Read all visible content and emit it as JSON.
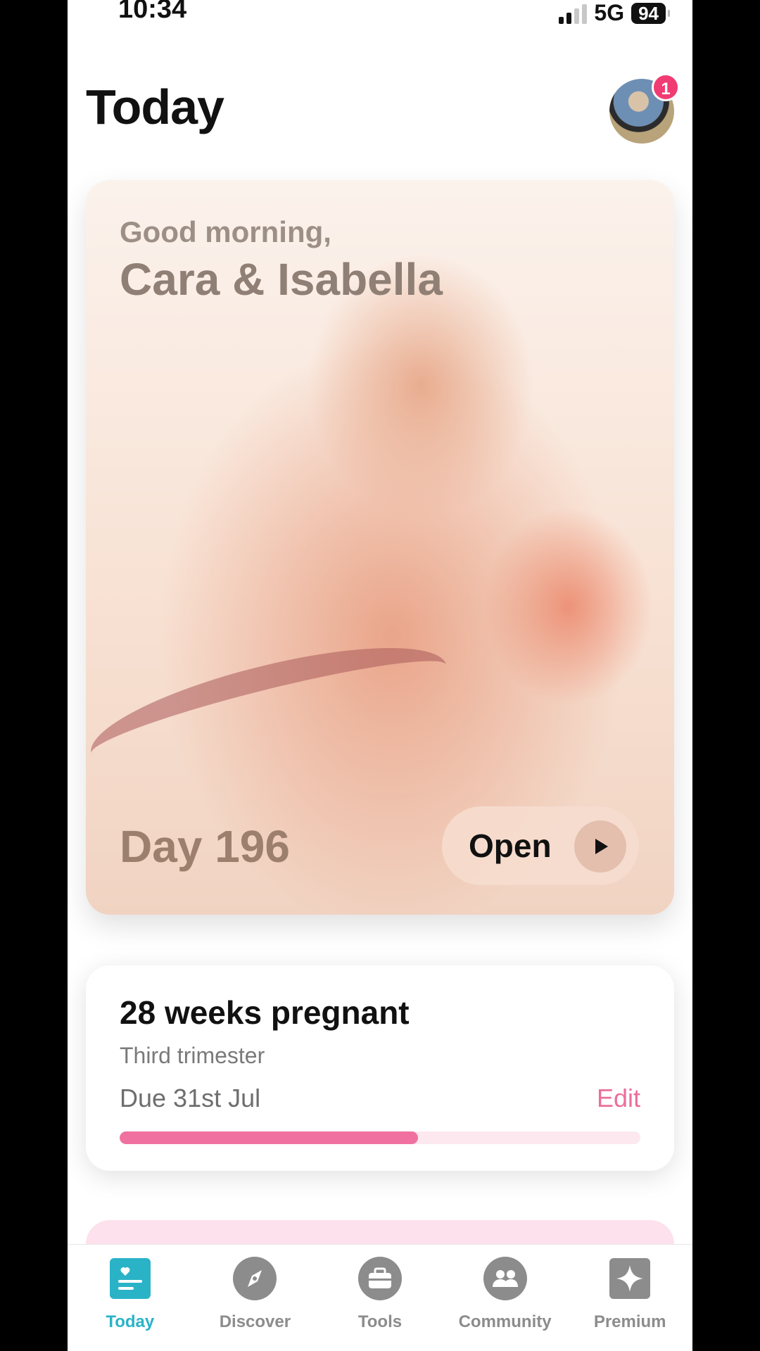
{
  "status_bar": {
    "time": "10:34",
    "network": "5G",
    "battery": "94"
  },
  "header": {
    "title": "Today",
    "notification_count": "1"
  },
  "hero": {
    "greeting": "Good morning,",
    "name": "Cara & Isabella",
    "day": "Day 196",
    "open_label": "Open"
  },
  "pregnancy": {
    "title": "28 weeks pregnant",
    "trimester": "Third trimester",
    "due": "Due 31st Jul",
    "edit_label": "Edit",
    "progress_fraction": 0.573
  },
  "tabs": [
    {
      "label": "Today",
      "icon": "today-icon",
      "active": true
    },
    {
      "label": "Discover",
      "icon": "compass-icon",
      "active": false
    },
    {
      "label": "Tools",
      "icon": "briefcase-icon",
      "active": false
    },
    {
      "label": "Community",
      "icon": "people-icon",
      "active": false
    },
    {
      "label": "Premium",
      "icon": "sparkle-icon",
      "active": false
    }
  ],
  "colors": {
    "accent_pink": "#f0719f",
    "accent_teal": "#2ab3c7",
    "badge_red": "#f03c72"
  }
}
